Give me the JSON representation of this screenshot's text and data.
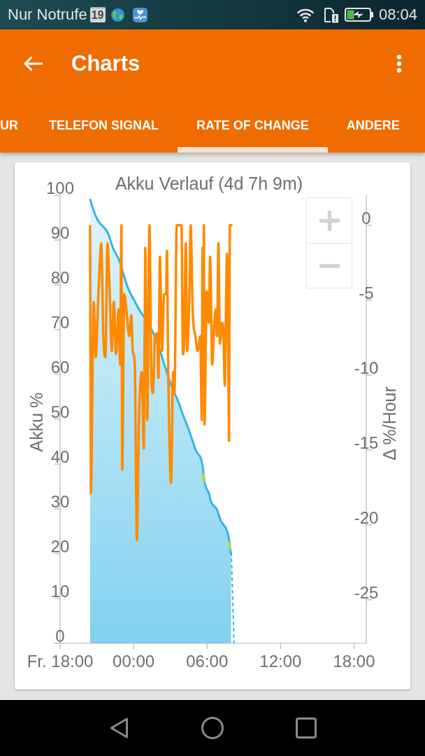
{
  "status_bar": {
    "carrier": "Nur Notrufe",
    "calendar_day": "19",
    "time": "08:04"
  },
  "app_bar": {
    "title": "Charts"
  },
  "tabs": [
    {
      "label": "UR",
      "selected": false
    },
    {
      "label": "TELEFON SIGNAL",
      "selected": false
    },
    {
      "label": "RATE OF CHANGE",
      "selected": true
    },
    {
      "label": "ANDERE",
      "selected": false
    }
  ],
  "chart": {
    "chart_data": {
      "type": "line",
      "title": "Akku Verlauf (4d 7h 9m)",
      "ylabel": "Akku %",
      "y2label": "Δ %/Hour",
      "xlim": [
        -6,
        19
      ],
      "ylim": [
        0,
        100
      ],
      "y2lim": [
        -27.9,
        2
      ],
      "xticks": [
        {
          "value": -6,
          "label": "Fr. 18:00"
        },
        {
          "value": 0,
          "label": "00:00"
        },
        {
          "value": 6,
          "label": "06:00"
        },
        {
          "value": 12,
          "label": "12:00"
        },
        {
          "value": 18,
          "label": "18:00"
        }
      ],
      "yticks": [
        0,
        10,
        20,
        30,
        40,
        50,
        60,
        70,
        80,
        90,
        100
      ],
      "y2ticks": [
        0,
        -5,
        -10,
        -15,
        -20,
        -25
      ],
      "series": [
        {
          "type": "area",
          "color": "#33b5e5",
          "x": [
            -3.55,
            -3.34,
            -2.92,
            -2.1,
            -1.68,
            -1.16,
            -0.85,
            -0.44,
            -0.02,
            0.5,
            1.07,
            1.75,
            2.38,
            2.83,
            3.17,
            3.63,
            4.03,
            4.48,
            5.05,
            5.68,
            5.74,
            6.19,
            6.3,
            6.82,
            7.11,
            7.65,
            7.81,
            7.85,
            7.96
          ],
          "values": [
            99.2,
            97.2,
            94.4,
            91.6,
            88.2,
            85.4,
            82.6,
            79.2,
            76.9,
            74.3,
            71.9,
            68.4,
            63.4,
            59.5,
            56.9,
            54.1,
            51,
            47.9,
            43.3,
            38.8,
            36.9,
            33.1,
            31.7,
            29.8,
            27.4,
            25,
            22.9,
            21.9,
            19.8
          ]
        },
        {
          "type": "line",
          "line_style": "dashed",
          "color": "#33b5e5",
          "x": [
            7.98,
            8.2
          ],
          "values": [
            20.3,
            0
          ]
        },
        {
          "type": "line",
          "color": "#b5d334",
          "x": [
            5.71,
            5.76
          ],
          "values": [
            37.9,
            35.9
          ]
        },
        {
          "type": "line",
          "color": "#b5d334",
          "x": [
            7.83,
            7.88
          ],
          "values": [
            22.7,
            20.9
          ]
        },
        {
          "type": "line",
          "axis": "y2",
          "color": "#ff8a00",
          "x": [
            -3.55,
            -3.49,
            -3.26,
            -3.09,
            -2.87,
            -2.64,
            -2.47,
            -2.3,
            -2.13,
            -1.95,
            -1.78,
            -1.61,
            -1.44,
            -1.21,
            -1.1,
            -0.99,
            -0.93,
            -0.76,
            -0.59,
            -0.36,
            -0.19,
            -0.07,
            0.1,
            0.27,
            0.44,
            0.67,
            0.84,
            0.95,
            1.12,
            1.29,
            1.46,
            1.58,
            1.75,
            1.92,
            2.03,
            2.15,
            2.32,
            2.49,
            2.66,
            2.72,
            2.83,
            3.06,
            3.23,
            3.34,
            3.52,
            3.91,
            4.03,
            4.14,
            4.26,
            4.37,
            4.54,
            4.66,
            4.83,
            5.05,
            5.23,
            5.45,
            5.57,
            5.62,
            5.68,
            5.74,
            5.79,
            5.97,
            6.14,
            6.25,
            6.42,
            6.59,
            6.71,
            6.82,
            6.93,
            7.05,
            7.22,
            7.33,
            7.45,
            7.56,
            7.62,
            7.73,
            7.79,
            7.85,
            8.07
          ],
          "values": [
            0,
            -17.9,
            -5.1,
            -8.8,
            -4.6,
            -1.2,
            -7.4,
            -8.8,
            -1.2,
            -4.6,
            -8.4,
            -5.1,
            -8.6,
            -5.6,
            -9.3,
            0,
            -16.3,
            -4.6,
            -5.6,
            -7.4,
            -6,
            -8.4,
            -9.3,
            -21,
            -13,
            -9.8,
            -14.9,
            -1.5,
            -13,
            0,
            -10.2,
            -11.2,
            -7.4,
            -7.2,
            -10.2,
            -2.1,
            -8.4,
            -4.6,
            -4.6,
            -1.7,
            -9.8,
            -17.2,
            -9.8,
            -11.2,
            0,
            0,
            -8.6,
            -7.4,
            -1.2,
            -8.4,
            -5.1,
            0,
            -5.8,
            -7.4,
            -8.4,
            -7.4,
            -13,
            -1.5,
            -8.4,
            0,
            -13.3,
            -4.4,
            -6.5,
            -2.1,
            -9.3,
            -6.5,
            -5.6,
            -7.4,
            -1.2,
            -7.9,
            -6.5,
            -7,
            -10.7,
            -4.6,
            -1.9,
            -7.9,
            -14.4,
            0,
            0
          ]
        }
      ]
    }
  }
}
